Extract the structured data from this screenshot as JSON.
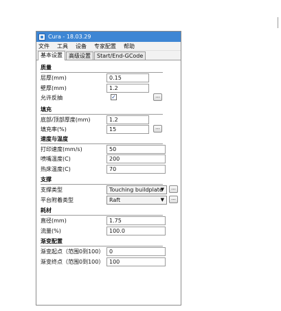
{
  "window": {
    "title": "Cura - 18.03.29"
  },
  "menu": [
    "文件",
    "工具",
    "设备",
    "专家配置",
    "帮助"
  ],
  "tabs": [
    "基本设置",
    "高级设置",
    "Start/End-GCode"
  ],
  "sections": {
    "quality": {
      "title": "质量",
      "layer_height_label": "层厚(mm)",
      "layer_height_value": "0.15",
      "shell_label": "壁厚(mm)",
      "shell_value": "1.2",
      "retraction_label": "允许反抽",
      "retraction_checked": true
    },
    "fill": {
      "title": "填充",
      "topbottom_label": "底部/顶部厚度(mm)",
      "topbottom_value": "1.2",
      "density_label": "填充率(%)",
      "density_value": "15"
    },
    "speed": {
      "title": "速度与温度",
      "print_speed_label": "打印速度(mm/s)",
      "print_speed_value": "50",
      "nozzle_temp_label": "喷嘴温度(C)",
      "nozzle_temp_value": "200",
      "bed_temp_label": "热床温度(C)",
      "bed_temp_value": "70"
    },
    "support": {
      "title": "支撑",
      "support_type_label": "支撑类型",
      "support_type_value": "Touching buildplate",
      "adhesion_label": "平台附着类型",
      "adhesion_value": "Raft"
    },
    "filament": {
      "title": "耗材",
      "diameter_label": "直径(mm)",
      "diameter_value": "1.75",
      "flow_label": "流量(%)",
      "flow_value": "100.0"
    },
    "gradient": {
      "title": "渐变配置",
      "start_label": "渐变起点（范围0到100）",
      "start_value": "0",
      "end_label": "渐变终点（范围0到100）",
      "end_value": "100"
    }
  },
  "dots_label": "...",
  "checkmark": "✓",
  "caret": "▼"
}
